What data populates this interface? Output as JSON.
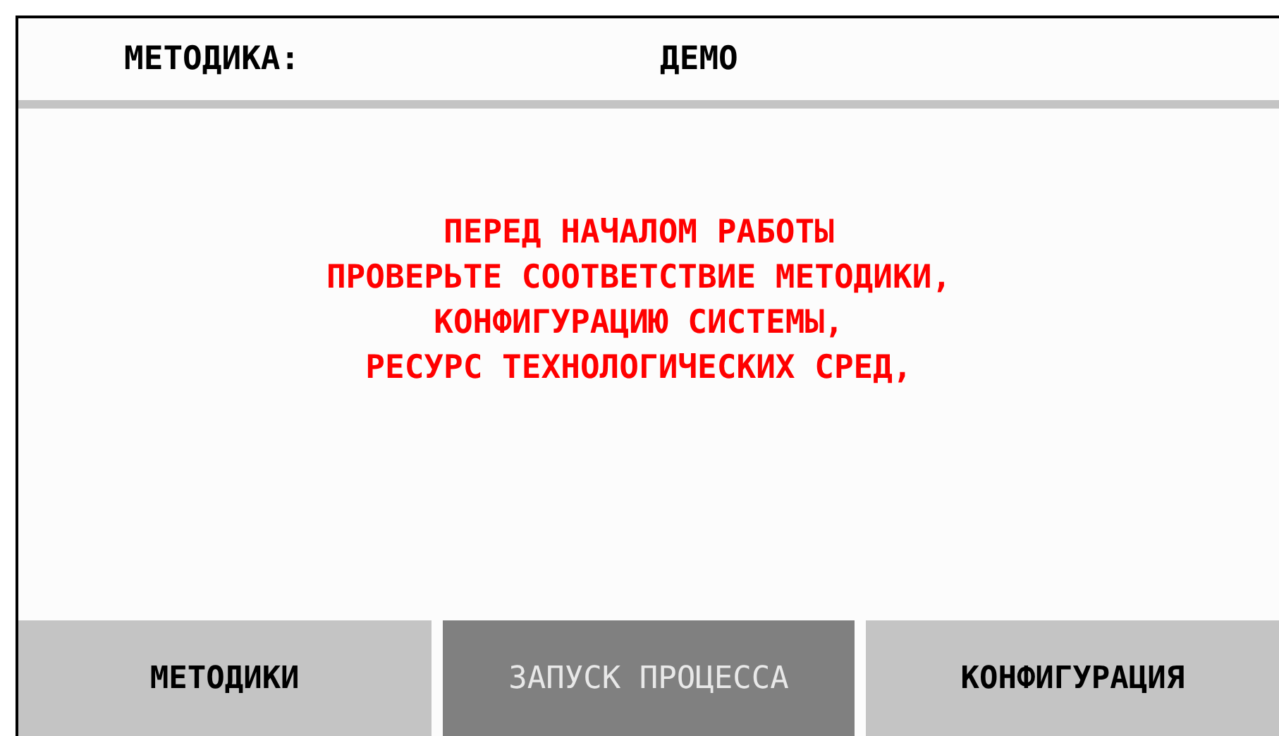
{
  "header": {
    "label": "МЕТОДИКА:",
    "value": "ДЕМО"
  },
  "message": [
    "ПЕРЕД НАЧАЛОМ РАБОТЫ",
    "ПРОВЕРЬТЕ СООТВЕТСТВИЕ МЕТОДИКИ,",
    "КОНФИГУРАЦИЮ СИСТЕМЫ,",
    "РЕСУРС ТЕХНОЛОГИЧЕСКИХ СРЕД,"
  ],
  "buttons": [
    {
      "label": "МЕТОДИКИ",
      "disabled": false
    },
    {
      "label": "ЗАПУСК ПРОЦЕССА",
      "disabled": true
    },
    {
      "label": "КОНФИГУРАЦИЯ",
      "disabled": false
    }
  ]
}
